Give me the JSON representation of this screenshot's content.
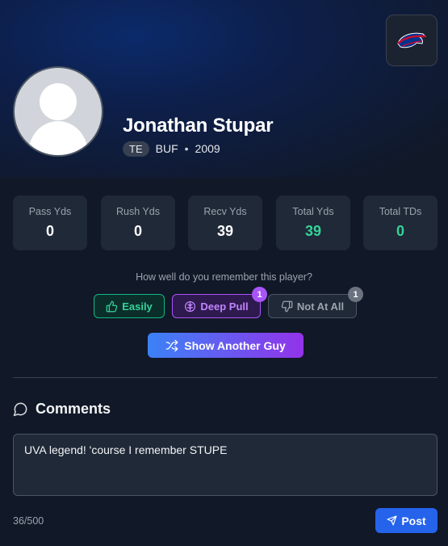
{
  "team": {
    "logo_icon": "bills-helmet-icon",
    "code": "BUF",
    "colors": {
      "primary": "#00338D",
      "secondary": "#C60C30"
    }
  },
  "player": {
    "name": "Jonathan Stupar",
    "position": "TE",
    "team": "BUF",
    "separator": "•",
    "year": "2009",
    "avatar_icon": "default-avatar-icon"
  },
  "stats": [
    {
      "label": "Pass Yds",
      "value": "0"
    },
    {
      "label": "Rush Yds",
      "value": "0"
    },
    {
      "label": "Recv Yds",
      "value": "39"
    },
    {
      "label": "Total Yds",
      "value": "39"
    },
    {
      "label": "Total TDs",
      "value": "0"
    }
  ],
  "recall": {
    "question": "How well do you remember this player?",
    "options": [
      {
        "label": "Easily",
        "icon": "thumbs-up-icon",
        "count": null,
        "color": "#10b981"
      },
      {
        "label": "Deep Pull",
        "icon": "brain-icon",
        "count": "1",
        "color": "#a855f7"
      },
      {
        "label": "Not At All",
        "icon": "thumbs-down-icon",
        "count": "1",
        "color": "#6b7280"
      }
    ]
  },
  "actions": {
    "another_label": "Show Another Guy",
    "another_icon": "shuffle-icon"
  },
  "comments": {
    "title": "Comments",
    "title_icon": "speech-bubble-icon",
    "input_value": "UVA legend! 'course I remember STUPE",
    "char_count": "36/500",
    "post_label": "Post",
    "post_icon": "send-icon"
  }
}
